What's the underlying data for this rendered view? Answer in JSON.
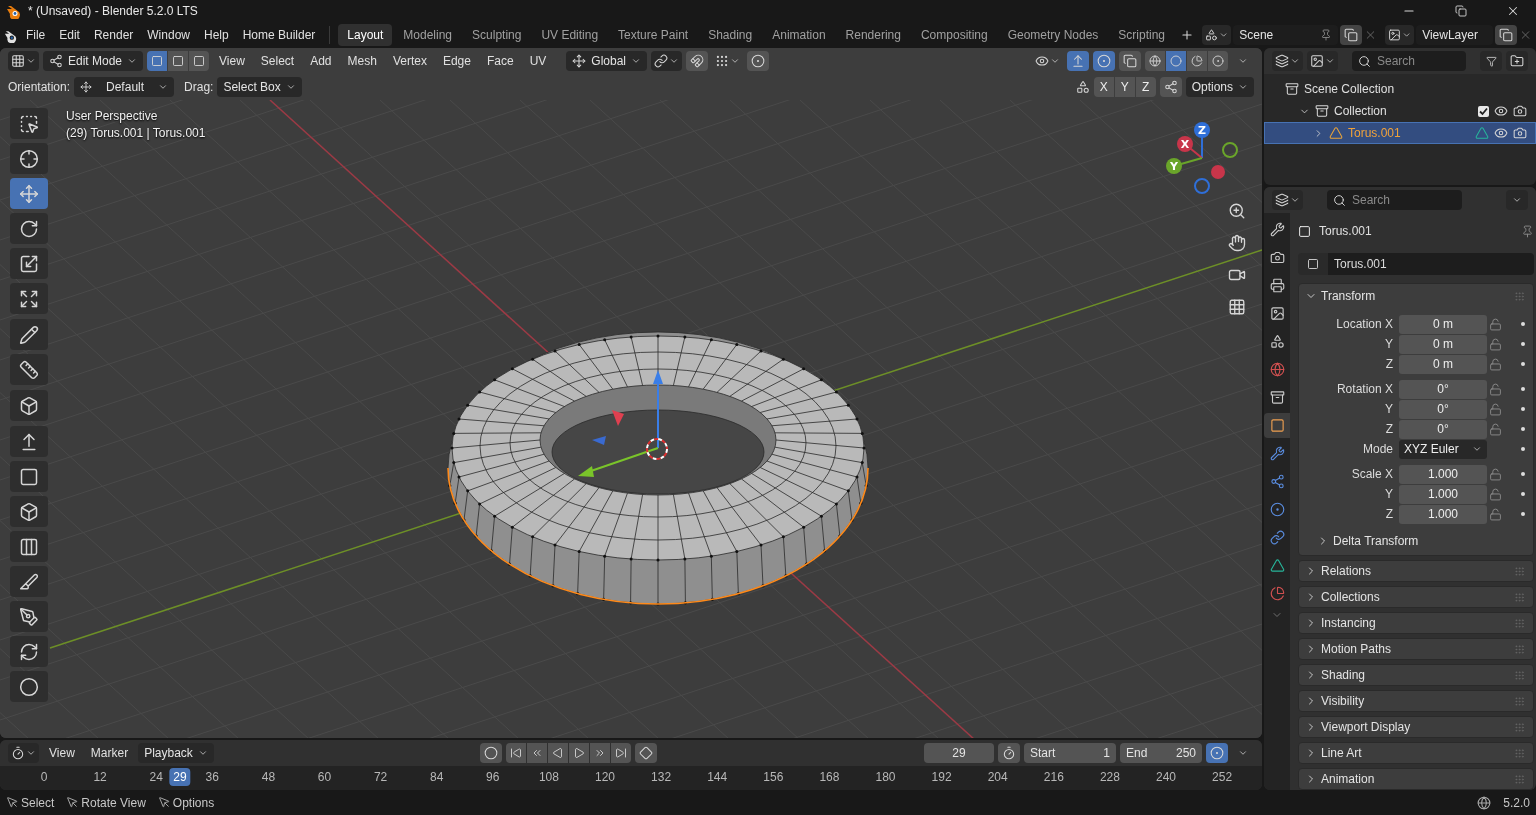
{
  "window": {
    "title": "* (Unsaved) - Blender 5.2.0 LTS"
  },
  "menu": [
    "File",
    "Edit",
    "Render",
    "Window",
    "Help",
    "Home Builder"
  ],
  "workspaces": [
    {
      "label": "Layout",
      "selected": true
    },
    {
      "label": "Modeling",
      "selected": false
    },
    {
      "label": "Sculpting",
      "selected": false
    },
    {
      "label": "UV Editing",
      "selected": false
    },
    {
      "label": "Texture Paint",
      "selected": false
    },
    {
      "label": "Shading",
      "selected": false
    },
    {
      "label": "Animation",
      "selected": false
    },
    {
      "label": "Rendering",
      "selected": false
    },
    {
      "label": "Compositing",
      "selected": false
    },
    {
      "label": "Geometry Nodes",
      "selected": false
    },
    {
      "label": "Scripting",
      "selected": false
    }
  ],
  "scene": "Scene",
  "view_layer": "ViewLayer",
  "viewport": {
    "mode": "Edit Mode",
    "select_modes": [
      {
        "selected": true
      },
      {
        "selected": false
      },
      {
        "selected": false
      }
    ],
    "menus": [
      "View",
      "Select",
      "Add",
      "Mesh",
      "Vertex",
      "Edge",
      "Face",
      "UV"
    ],
    "transform_orientation": "Global",
    "gizmos_on": true,
    "overlays_on": true,
    "shading": [
      {
        "selected": false
      },
      {
        "selected": true
      },
      {
        "selected": false
      },
      {
        "selected": false
      }
    ],
    "orientation_label": "Orientation:",
    "orientation": "Default",
    "drag_label": "Drag:",
    "drag": "Select Box",
    "mirror_axes": [
      "X",
      "Y",
      "Z"
    ],
    "options": "Options",
    "overlay_title": "User Perspective",
    "overlay_object": "(29) Torus.001 | Torus.001",
    "navigation_gizmo": [
      {
        "label": "Z",
        "color": "#2f6fd8"
      },
      {
        "label": "X",
        "color": "#c8354a"
      },
      {
        "label": "Y",
        "color": "#6aa52a"
      }
    ],
    "tool_groups": [
      [
        {
          "selected": false
        },
        {
          "selected": false
        },
        {
          "selected": true
        },
        {
          "selected": false
        },
        {
          "selected": false
        },
        {
          "selected": false
        }
      ],
      [
        {
          "selected": false
        },
        {
          "selected": false
        }
      ],
      [
        {
          "selected": false
        }
      ],
      [
        {
          "selected": false
        },
        {
          "selected": false
        },
        {
          "selected": false
        },
        {
          "selected": false
        },
        {
          "selected": false
        },
        {
          "selected": false
        },
        {
          "selected": false
        },
        {
          "selected": false
        }
      ]
    ]
  },
  "outliner": {
    "search": {
      "placeholder": "Search"
    },
    "tree": [
      {
        "label": "Scene Collection",
        "children": [
          {
            "label": "Collection",
            "expanded": true,
            "checked": true,
            "selected": false,
            "children": [
              {
                "label": "Torus.001",
                "expanded": false,
                "selected": true
              }
            ]
          }
        ]
      }
    ]
  },
  "properties": {
    "search": {
      "placeholder": "Search"
    },
    "tabs": [
      {
        "selected": false
      },
      {
        "selected": false
      },
      {
        "selected": false
      },
      {
        "selected": false
      },
      {
        "selected": false
      },
      {
        "selected": false
      },
      {
        "selected": false
      },
      {
        "selected": true
      },
      {
        "selected": false
      },
      {
        "selected": false
      },
      {
        "selected": false
      },
      {
        "selected": false
      },
      {
        "selected": false
      },
      {
        "selected": false
      }
    ],
    "object": "Torus.001",
    "name_field": "Torus.001",
    "transform": {
      "title": "Transform",
      "expanded": true,
      "groups": [
        [
          {
            "kind": "number",
            "label": "Location X",
            "value": "0 m"
          },
          {
            "kind": "number",
            "label": "Y",
            "value": "0 m"
          },
          {
            "kind": "number",
            "label": "Z",
            "value": "0 m"
          }
        ],
        [
          {
            "kind": "number",
            "label": "Rotation X",
            "value": "0°"
          },
          {
            "kind": "number",
            "label": "Y",
            "value": "0°"
          },
          {
            "kind": "number",
            "label": "Z",
            "value": "0°"
          },
          {
            "kind": "dropdown",
            "label": "Mode",
            "value": "XYZ Euler"
          }
        ],
        [
          {
            "kind": "number",
            "label": "Scale X",
            "value": "1.000"
          },
          {
            "kind": "number",
            "label": "Y",
            "value": "1.000"
          },
          {
            "kind": "number",
            "label": "Z",
            "value": "1.000"
          }
        ]
      ],
      "subpanel": {
        "title": "Delta Transform",
        "expanded": false
      }
    },
    "panels": [
      {
        "title": "Relations",
        "expanded": false
      },
      {
        "title": "Collections",
        "expanded": false
      },
      {
        "title": "Instancing",
        "expanded": false
      },
      {
        "title": "Motion Paths",
        "expanded": false
      },
      {
        "title": "Shading",
        "expanded": false
      },
      {
        "title": "Visibility",
        "expanded": false
      },
      {
        "title": "Viewport Display",
        "expanded": false
      },
      {
        "title": "Line Art",
        "expanded": false
      },
      {
        "title": "Animation",
        "expanded": false
      }
    ]
  },
  "timeline": {
    "menus": [
      "View",
      "Marker"
    ],
    "playback": "Playback",
    "current_frame": "29",
    "start_label": "Start",
    "start": "1",
    "end_label": "End",
    "end": "250",
    "ticks": [
      "0",
      "12",
      "24",
      "36",
      "48",
      "60",
      "72",
      "84",
      "96",
      "108",
      "120",
      "132",
      "144",
      "156",
      "168",
      "180",
      "192",
      "204",
      "216",
      "228",
      "240",
      "252"
    ],
    "playhead": "29"
  },
  "status_bar": {
    "hints": [
      "Select",
      "Rotate View",
      "Options"
    ],
    "version": "5.2.0"
  }
}
